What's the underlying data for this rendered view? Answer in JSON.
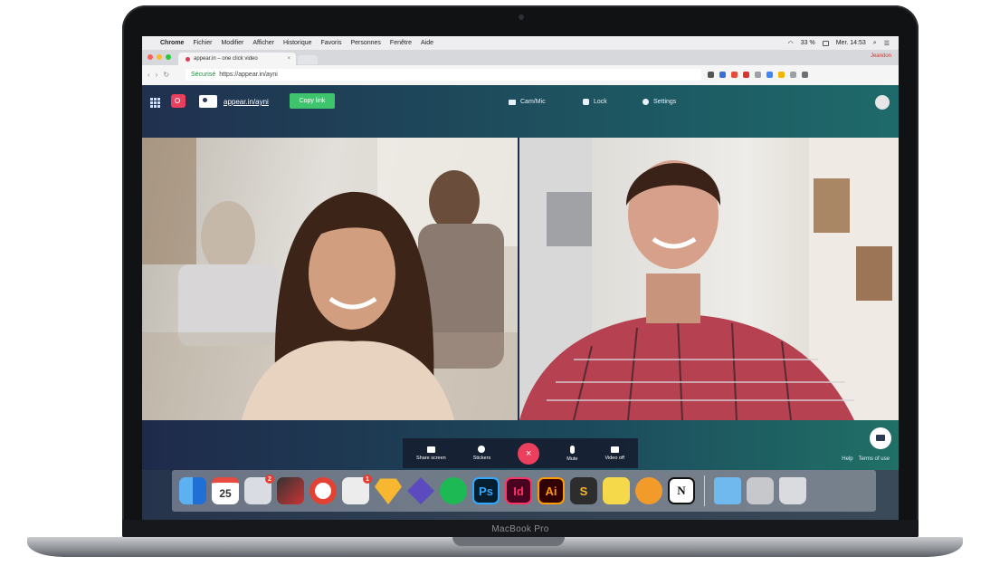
{
  "device": {
    "label": "MacBook Pro"
  },
  "menubar": {
    "app": "Chrome",
    "items": [
      "Fichier",
      "Modifier",
      "Afficher",
      "Historique",
      "Favoris",
      "Personnes",
      "Fenêtre",
      "Aide"
    ],
    "battery": "33 %",
    "clock": "Mer. 14:53"
  },
  "browser": {
    "tab_title": "appear.in – one click video",
    "profile": "Jeandon",
    "secure_label": "Sécurisé",
    "url": "https://appear.in/ayni"
  },
  "app": {
    "room_link": "appear.in/ayni",
    "copy_label": "Copy link",
    "cam_mic_label": "Cam/Mic",
    "lock_label": "Lock",
    "settings_label": "Settings"
  },
  "toolbar": {
    "share_label": "Share screen",
    "stickers_label": "Stickers",
    "hangup_glyph": "×",
    "mute_label": "Mute",
    "video_label": "Video off"
  },
  "footer": {
    "help": "Help",
    "terms": "Terms of use"
  },
  "dock": {
    "calendar_day": "25",
    "photoshop": "Ps",
    "indesign": "Id",
    "illustrator": "Ai",
    "notion": "N",
    "slack_badge": "1",
    "photos_badge": "2"
  },
  "colors": {
    "brand_red": "#ea3f5d",
    "copy_green": "#3ec46d",
    "header_gradient_start": "#20304f",
    "header_gradient_end": "#1e6a6a"
  }
}
